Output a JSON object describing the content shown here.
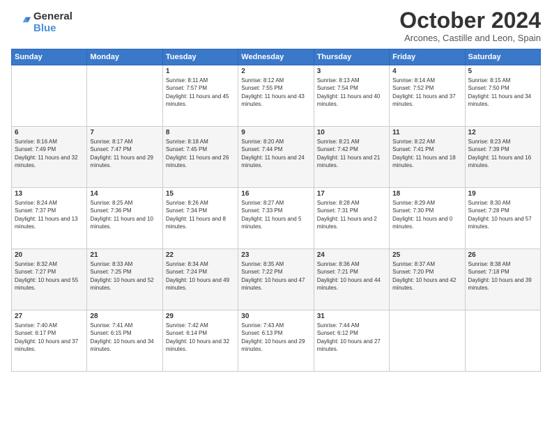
{
  "logo": {
    "general": "General",
    "blue": "Blue"
  },
  "header": {
    "month": "October 2024",
    "location": "Arcones, Castille and Leon, Spain"
  },
  "days_of_week": [
    "Sunday",
    "Monday",
    "Tuesday",
    "Wednesday",
    "Thursday",
    "Friday",
    "Saturday"
  ],
  "weeks": [
    [
      {
        "day": "",
        "info": ""
      },
      {
        "day": "",
        "info": ""
      },
      {
        "day": "1",
        "info": "Sunrise: 8:11 AM\nSunset: 7:57 PM\nDaylight: 11 hours and 45 minutes."
      },
      {
        "day": "2",
        "info": "Sunrise: 8:12 AM\nSunset: 7:55 PM\nDaylight: 11 hours and 43 minutes."
      },
      {
        "day": "3",
        "info": "Sunrise: 8:13 AM\nSunset: 7:54 PM\nDaylight: 11 hours and 40 minutes."
      },
      {
        "day": "4",
        "info": "Sunrise: 8:14 AM\nSunset: 7:52 PM\nDaylight: 11 hours and 37 minutes."
      },
      {
        "day": "5",
        "info": "Sunrise: 8:15 AM\nSunset: 7:50 PM\nDaylight: 11 hours and 34 minutes."
      }
    ],
    [
      {
        "day": "6",
        "info": "Sunrise: 8:16 AM\nSunset: 7:49 PM\nDaylight: 11 hours and 32 minutes."
      },
      {
        "day": "7",
        "info": "Sunrise: 8:17 AM\nSunset: 7:47 PM\nDaylight: 11 hours and 29 minutes."
      },
      {
        "day": "8",
        "info": "Sunrise: 8:18 AM\nSunset: 7:45 PM\nDaylight: 11 hours and 26 minutes."
      },
      {
        "day": "9",
        "info": "Sunrise: 8:20 AM\nSunset: 7:44 PM\nDaylight: 11 hours and 24 minutes."
      },
      {
        "day": "10",
        "info": "Sunrise: 8:21 AM\nSunset: 7:42 PM\nDaylight: 11 hours and 21 minutes."
      },
      {
        "day": "11",
        "info": "Sunrise: 8:22 AM\nSunset: 7:41 PM\nDaylight: 11 hours and 18 minutes."
      },
      {
        "day": "12",
        "info": "Sunrise: 8:23 AM\nSunset: 7:39 PM\nDaylight: 11 hours and 16 minutes."
      }
    ],
    [
      {
        "day": "13",
        "info": "Sunrise: 8:24 AM\nSunset: 7:37 PM\nDaylight: 11 hours and 13 minutes."
      },
      {
        "day": "14",
        "info": "Sunrise: 8:25 AM\nSunset: 7:36 PM\nDaylight: 11 hours and 10 minutes."
      },
      {
        "day": "15",
        "info": "Sunrise: 8:26 AM\nSunset: 7:34 PM\nDaylight: 11 hours and 8 minutes."
      },
      {
        "day": "16",
        "info": "Sunrise: 8:27 AM\nSunset: 7:33 PM\nDaylight: 11 hours and 5 minutes."
      },
      {
        "day": "17",
        "info": "Sunrise: 8:28 AM\nSunset: 7:31 PM\nDaylight: 11 hours and 2 minutes."
      },
      {
        "day": "18",
        "info": "Sunrise: 8:29 AM\nSunset: 7:30 PM\nDaylight: 11 hours and 0 minutes."
      },
      {
        "day": "19",
        "info": "Sunrise: 8:30 AM\nSunset: 7:28 PM\nDaylight: 10 hours and 57 minutes."
      }
    ],
    [
      {
        "day": "20",
        "info": "Sunrise: 8:32 AM\nSunset: 7:27 PM\nDaylight: 10 hours and 55 minutes."
      },
      {
        "day": "21",
        "info": "Sunrise: 8:33 AM\nSunset: 7:25 PM\nDaylight: 10 hours and 52 minutes."
      },
      {
        "day": "22",
        "info": "Sunrise: 8:34 AM\nSunset: 7:24 PM\nDaylight: 10 hours and 49 minutes."
      },
      {
        "day": "23",
        "info": "Sunrise: 8:35 AM\nSunset: 7:22 PM\nDaylight: 10 hours and 47 minutes."
      },
      {
        "day": "24",
        "info": "Sunrise: 8:36 AM\nSunset: 7:21 PM\nDaylight: 10 hours and 44 minutes."
      },
      {
        "day": "25",
        "info": "Sunrise: 8:37 AM\nSunset: 7:20 PM\nDaylight: 10 hours and 42 minutes."
      },
      {
        "day": "26",
        "info": "Sunrise: 8:38 AM\nSunset: 7:18 PM\nDaylight: 10 hours and 39 minutes."
      }
    ],
    [
      {
        "day": "27",
        "info": "Sunrise: 7:40 AM\nSunset: 6:17 PM\nDaylight: 10 hours and 37 minutes."
      },
      {
        "day": "28",
        "info": "Sunrise: 7:41 AM\nSunset: 6:15 PM\nDaylight: 10 hours and 34 minutes."
      },
      {
        "day": "29",
        "info": "Sunrise: 7:42 AM\nSunset: 6:14 PM\nDaylight: 10 hours and 32 minutes."
      },
      {
        "day": "30",
        "info": "Sunrise: 7:43 AM\nSunset: 6:13 PM\nDaylight: 10 hours and 29 minutes."
      },
      {
        "day": "31",
        "info": "Sunrise: 7:44 AM\nSunset: 6:12 PM\nDaylight: 10 hours and 27 minutes."
      },
      {
        "day": "",
        "info": ""
      },
      {
        "day": "",
        "info": ""
      }
    ]
  ]
}
